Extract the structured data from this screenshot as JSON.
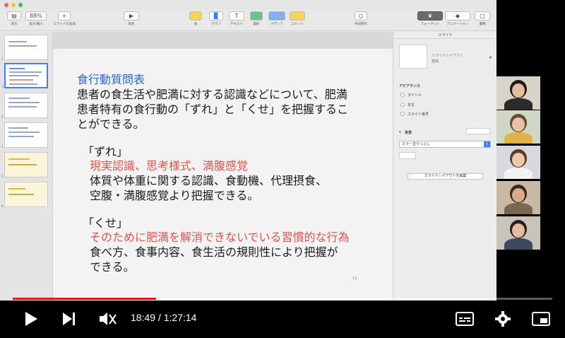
{
  "window": {
    "traffic_lights": [
      "#ff5f57",
      "#febc2e",
      "#28c840"
    ]
  },
  "toolbar": {
    "items": [
      {
        "label": "表示"
      },
      {
        "label": "拡大/縮小",
        "value": "88%"
      },
      {
        "label": "スライドを追加"
      },
      {
        "label": "再生"
      },
      {
        "label": "表"
      },
      {
        "label": "グラフ"
      },
      {
        "label": "テキスト"
      },
      {
        "label": "図形"
      },
      {
        "label": "メディア"
      },
      {
        "label": "コメント"
      },
      {
        "label": "共同制作"
      },
      {
        "label": "フォーマット"
      },
      {
        "label": "アニメーション"
      },
      {
        "label": "書類"
      }
    ]
  },
  "thumbnails": {
    "numbers": [
      "1",
      "2",
      "3",
      "4",
      "5",
      "6"
    ],
    "selected_index": 1
  },
  "slide": {
    "title": "食行動質問表",
    "intro_lines": [
      "患者の食生活や肥満に対する認識などについて、肥満",
      "患者特有の食行動の「ずれ」と「くせ」を把握するこ",
      "とができる。"
    ],
    "zure_heading": "「ずれ」",
    "zure_keywords": "現実認識、思考様式、満腹感覚",
    "zure_lines": [
      "体質や体重に関する認識、食動機、代理摂食、",
      "空腹・満腹感覚より把握できる。"
    ],
    "kuse_heading": "「くせ」",
    "kuse_keywords": "そのために肥満を解消できないでいる習慣的な行為",
    "kuse_lines": [
      "食べ方、食事内容、食生活の規則性により把握が",
      "できる。"
    ],
    "page_number": "13"
  },
  "inspector": {
    "header": "スライド",
    "layout_label": "スライドレイアウト",
    "layout_value": "空白",
    "appearance_title": "アピアランス",
    "options": [
      "タイトル",
      "本文",
      "スライド番号"
    ],
    "background_title": "背景",
    "fill_select": "カラー塗りつぶし",
    "edit_layout_button": "スライドレイアウトを編集"
  },
  "participants": [
    {
      "bg": "#d9d2c7",
      "skin": "#e2bda0",
      "hair": "#1f1a18",
      "shirt": "#2b2b2b"
    },
    {
      "bg": "#cfd8c6",
      "skin": "#e6c3a6",
      "hair": "#6b4a34",
      "shirt": "#e0b246"
    },
    {
      "bg": "#d7d9dd",
      "skin": "#ecc9ae",
      "hair": "#5a3b28",
      "shirt": "#f2f2f2"
    },
    {
      "bg": "#c9b9a4",
      "skin": "#d9ab86",
      "hair": "#3b2a20",
      "shirt": "#7b6752"
    },
    {
      "bg": "#c8c3bb",
      "skin": "#e3bd9e",
      "hair": "#2a211c",
      "shirt": "#3b4a5c"
    }
  ],
  "player": {
    "time_display": "18:49 / 1:27:14",
    "progress_fraction": 0.266,
    "accent": "#ff0000"
  }
}
